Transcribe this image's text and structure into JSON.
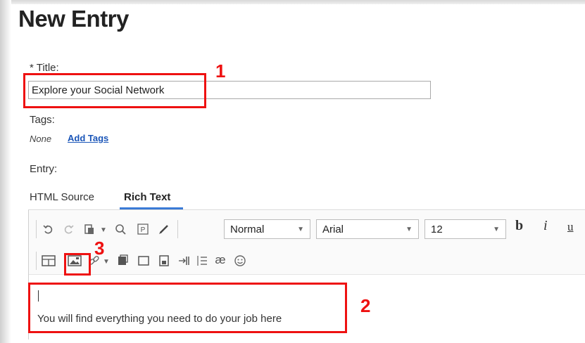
{
  "page_title": "New Entry",
  "title_field": {
    "label": "* Title:",
    "value": "Explore your Social Network"
  },
  "tags": {
    "label": "Tags:",
    "none_text": "None",
    "add_link": "Add Tags"
  },
  "entry_label": "Entry:",
  "editor_tabs": [
    {
      "label": "HTML Source"
    },
    {
      "label": "Rich Text"
    }
  ],
  "toolbar": {
    "style_select": "Normal",
    "font_select": "Arial",
    "size_select": "12",
    "bold_glyph": "b",
    "italic_glyph": "i",
    "underline_glyph": "u",
    "special_char_glyph": "æ",
    "paragraph_glyph": "P"
  },
  "editor_body": {
    "text": "You will find everything you need to do your job here"
  },
  "callouts": {
    "one": "1",
    "two": "2",
    "three": "3"
  },
  "colors": {
    "callout_red": "#ee1111",
    "link_blue": "#1a55b8",
    "tab_underline": "#3b7bd6"
  }
}
